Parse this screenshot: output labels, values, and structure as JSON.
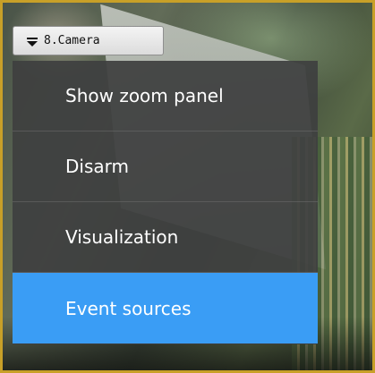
{
  "camera": {
    "button_label": "8.Camera",
    "icon": "filter-icon"
  },
  "menu": {
    "items": [
      {
        "label": "Show zoom panel",
        "active": false
      },
      {
        "label": "Disarm",
        "active": false
      },
      {
        "label": "Visualization",
        "active": false
      },
      {
        "label": "Event sources",
        "active": true
      }
    ]
  },
  "colors": {
    "frame_border": "#c8a028",
    "menu_background": "#3e4040",
    "active_item": "#3a9df5"
  }
}
